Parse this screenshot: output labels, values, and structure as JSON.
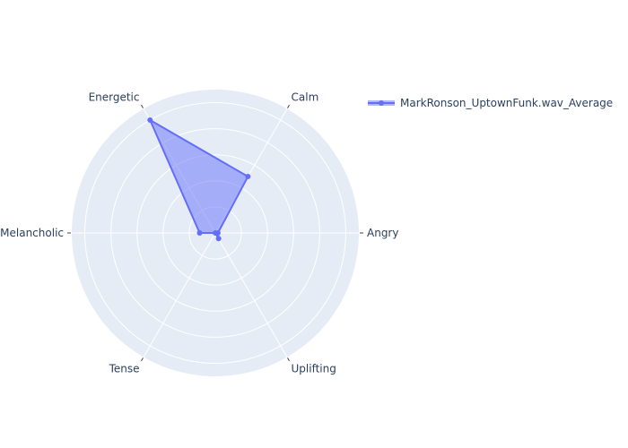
{
  "chart_data": {
    "type": "radar",
    "categories": [
      "Angry",
      "Calm",
      "Energetic",
      "Melancholic",
      "Tense",
      "Uplifting"
    ],
    "series": [
      {
        "name": "MarkRonson_UptownFunk.wav_Average",
        "values": [
          0.02,
          0.5,
          1.0,
          0.12,
          0.0,
          0.05
        ]
      }
    ],
    "radial_range": [
      0,
      1.1
    ],
    "radial_grid_step": 0.2,
    "grid": true,
    "legend_position": "top-right",
    "colors": {
      "polar_bg": "#e5ecf6",
      "grid": "#ffffff",
      "series_line": "#636efa",
      "series_fill": "#636efa",
      "text": "#2a3f5f"
    }
  }
}
